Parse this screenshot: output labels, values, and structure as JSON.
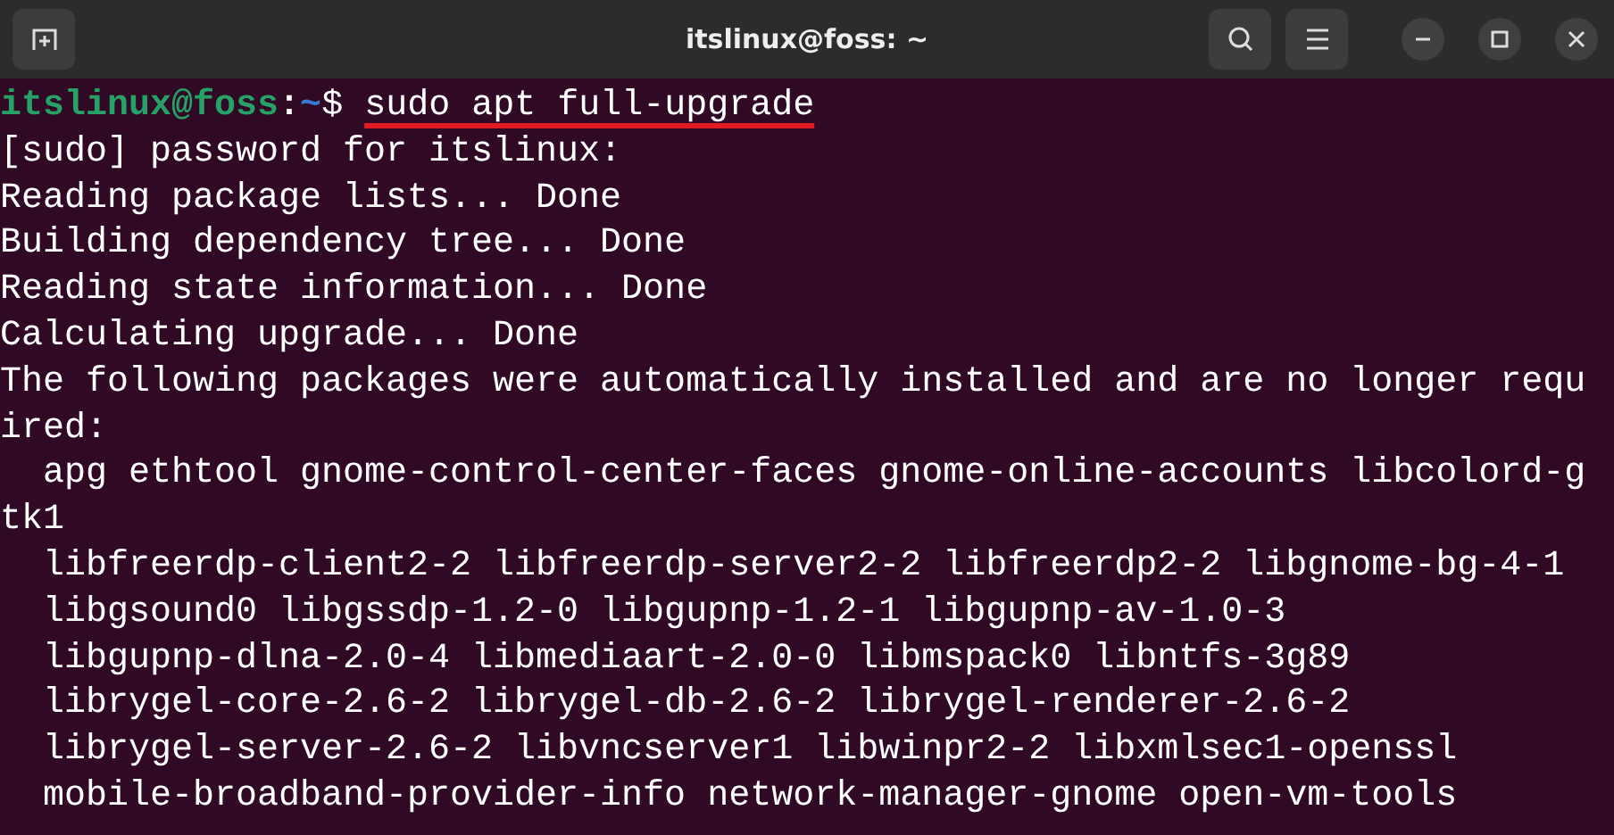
{
  "window": {
    "title": "itslinux@foss: ~"
  },
  "prompt": {
    "user_host": "itslinux@foss",
    "separator": ":",
    "path": "~",
    "symbol": "$",
    "command": "sudo apt full-upgrade",
    "underlined": true
  },
  "output_lines": [
    "[sudo] password for itslinux:",
    "Reading package lists... Done",
    "Building dependency tree... Done",
    "Reading state information... Done",
    "Calculating upgrade... Done",
    "The following packages were automatically installed and are no longer requ",
    "ired:",
    "  apg ethtool gnome-control-center-faces gnome-online-accounts libcolord-g",
    "tk1",
    "  libfreerdp-client2-2 libfreerdp-server2-2 libfreerdp2-2 libgnome-bg-4-1",
    "  libgsound0 libgssdp-1.2-0 libgupnp-1.2-1 libgupnp-av-1.0-3",
    "  libgupnp-dlna-2.0-4 libmediaart-2.0-0 libmspack0 libntfs-3g89",
    "  librygel-core-2.6-2 librygel-db-2.6-2 librygel-renderer-2.6-2",
    "  librygel-server-2.6-2 libvncserver1 libwinpr2-2 libxmlsec1-openssl",
    "  mobile-broadband-provider-info network-manager-gnome open-vm-tools"
  ]
}
